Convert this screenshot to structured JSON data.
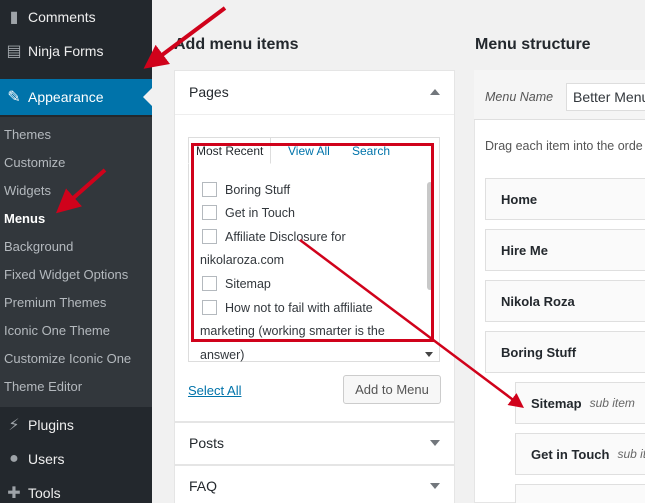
{
  "sidebar": {
    "items": [
      {
        "label": "Comments",
        "icon": "comment-icon"
      },
      {
        "label": "Ninja Forms",
        "icon": "forms-icon"
      },
      {
        "label": "Appearance",
        "icon": "paintbrush-icon"
      },
      {
        "label": "Plugins",
        "icon": "plugin-icon"
      },
      {
        "label": "Users",
        "icon": "user-icon"
      },
      {
        "label": "Tools",
        "icon": "wrench-icon"
      }
    ],
    "submenu": [
      "Themes",
      "Customize",
      "Widgets",
      "Menus",
      "Background",
      "Fixed Widget Options",
      "Premium Themes",
      "Iconic One Theme",
      "Customize Iconic One",
      "Theme Editor"
    ]
  },
  "add_menu": {
    "title": "Add menu items",
    "pages": {
      "heading": "Pages",
      "tabs": [
        "Most Recent",
        "View All",
        "Search"
      ],
      "items": [
        "Boring Stuff",
        "Get in Touch",
        "Affiliate Disclosure for",
        "nikolaroza.com",
        "Sitemap",
        "How not to fail with affiliate",
        "marketing (working smarter is the",
        "answer)"
      ],
      "select_all": "Select All",
      "add_button": "Add to Menu"
    },
    "sections": [
      "Posts",
      "FAQ"
    ]
  },
  "structure": {
    "title": "Menu structure",
    "menu_name_label": "Menu Name",
    "menu_name_value": "Better Menu",
    "instructions": "Drag each item into the orde",
    "items": [
      {
        "label": "Home",
        "sub": ""
      },
      {
        "label": "Hire Me",
        "sub": ""
      },
      {
        "label": "Nikola Roza",
        "sub": ""
      },
      {
        "label": "Boring Stuff",
        "sub": ""
      },
      {
        "label": "Sitemap",
        "sub": "sub item"
      },
      {
        "label": "Get in Touch",
        "sub": "sub it"
      }
    ]
  },
  "colors": {
    "accent": "#0073aa",
    "annotation": "#d0021b",
    "sidebar": "#23282d"
  }
}
